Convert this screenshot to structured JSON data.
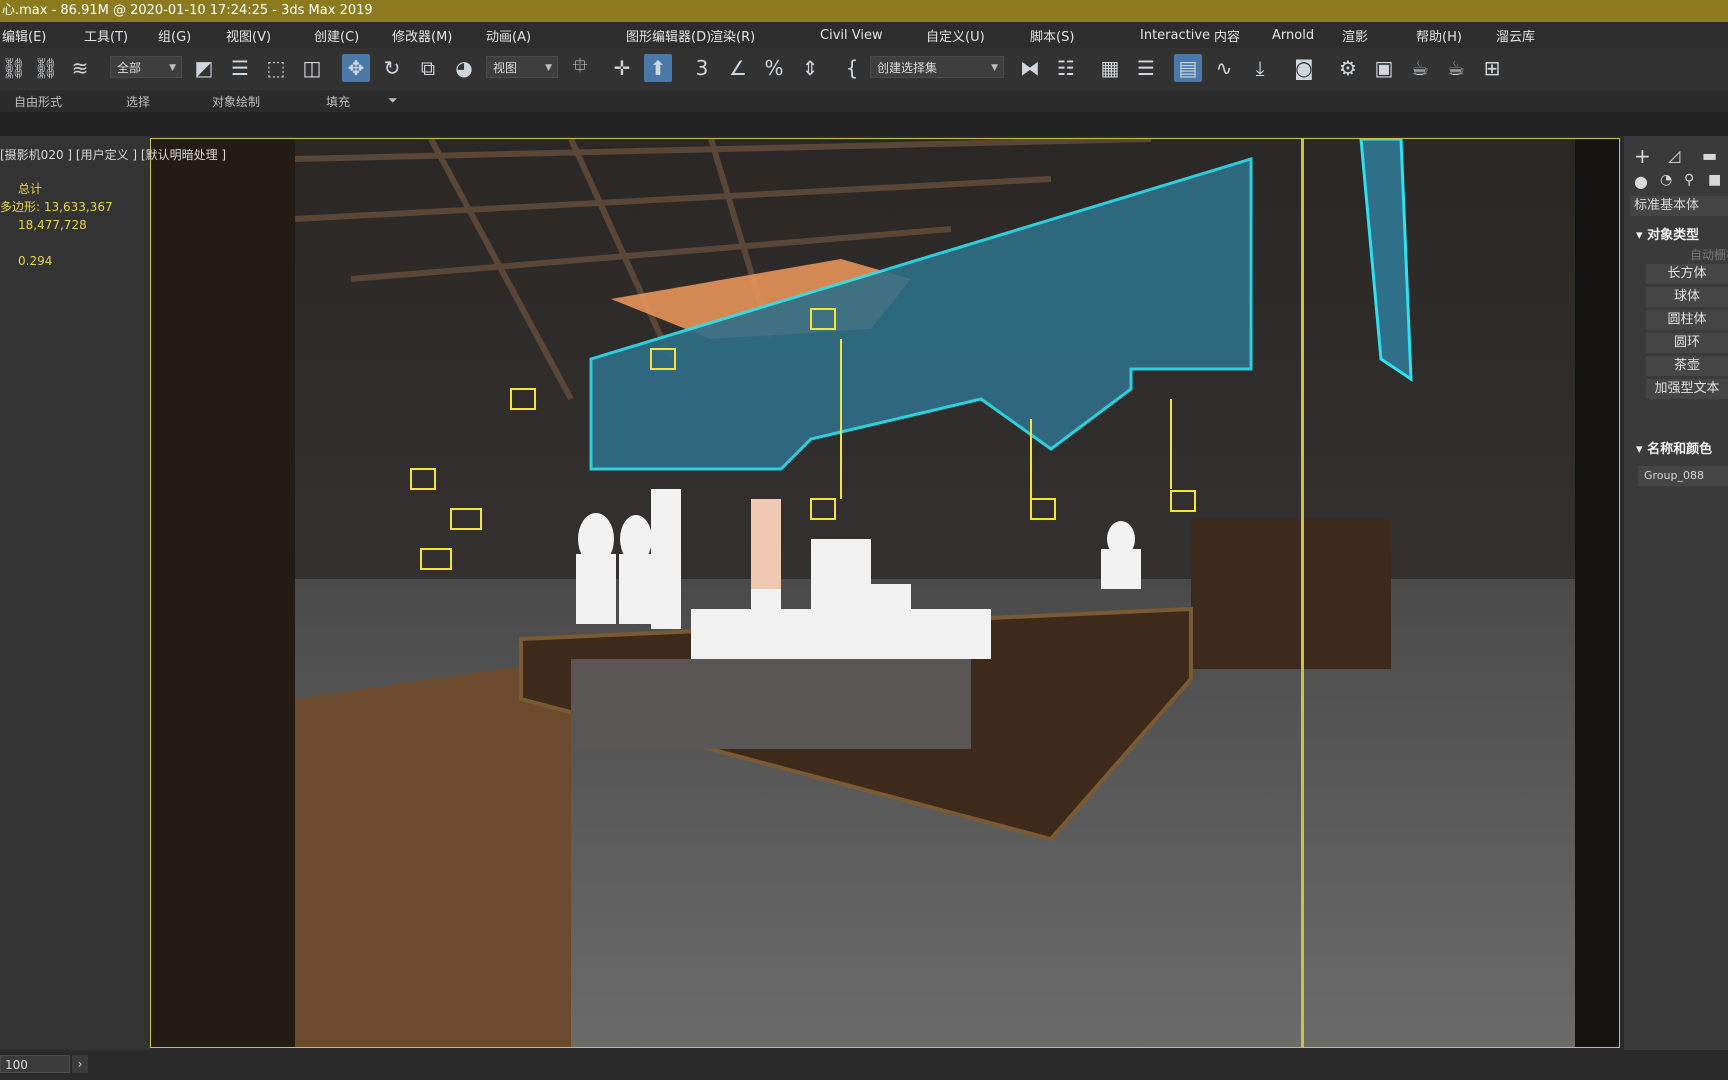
{
  "window": {
    "title": "心.max - 86.91M @ 2020-01-10 17:24:25 - 3ds Max 2019"
  },
  "menu": [
    "编辑(E)",
    "工具(T)",
    "组(G)",
    "视图(V)",
    "创建(C)",
    "修改器(M)",
    "动画(A)",
    "图形编辑器(D)",
    "渲染(R)",
    "Civil View",
    "自定义(U)",
    "脚本(S)",
    "Interactive",
    "内容",
    "Arnold",
    "渲影",
    "帮助(H)",
    "溜云库"
  ],
  "toolbar": {
    "filter_value": "全部",
    "refcoord_value": "视图",
    "selset_placeholder": "创建选择集",
    "icons": [
      "link-icon",
      "unlink-icon",
      "bind-spacewarp-icon",
      "select-object-icon",
      "select-by-name-icon",
      "rect-select-icon",
      "window-crossing-icon",
      "move-icon",
      "rotate-icon",
      "scale-icon",
      "place-icon",
      "pivot-icon",
      "snap-icon",
      "angle-snap-icon",
      "percent-snap-icon",
      "spinner-snap-icon",
      "mirror-icon",
      "align-icon",
      "scene-explorer-icon",
      "layer-explorer-icon",
      "toggle-ribbon-icon",
      "curve-editor-icon",
      "schematic-view-icon",
      "material-editor-icon",
      "render-setup-icon",
      "rendered-frame-icon",
      "render-icon",
      "render-iterative-icon",
      "grid-icon"
    ]
  },
  "ribbon": {
    "tabs": [
      "自由形式",
      "选择",
      "对象绘制",
      "填充"
    ]
  },
  "viewport": {
    "label": "[摄影机020 ] [用户定义 ] [默认明暗处理 ]",
    "stats": {
      "total_label": "总计",
      "polys_label": "多边形:",
      "polys": "13,633,367",
      "verts": "18,477,728",
      "fps": "0.294"
    }
  },
  "command_panel": {
    "category": "标准基本体",
    "object_type_header": "对象类型",
    "autogrid": "自动栅格",
    "buttons": [
      "长方体",
      "球体",
      "圆柱体",
      "圆环",
      "茶壶",
      "加强型文本"
    ],
    "name_color_header": "名称和颜色",
    "object_name": "Group_088"
  },
  "statusbar": {
    "frame": "100"
  }
}
